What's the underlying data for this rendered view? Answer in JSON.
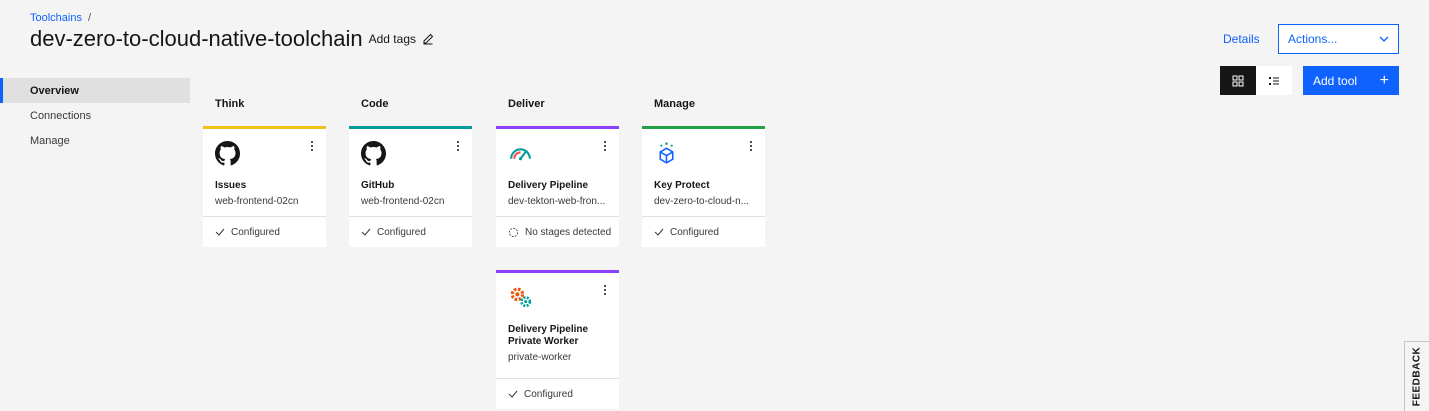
{
  "breadcrumb": {
    "link": "Toolchains",
    "separator": "/"
  },
  "page": {
    "title": "dev-zero-to-cloud-native-toolchain",
    "add_tags": "Add tags"
  },
  "header": {
    "details": "Details",
    "actions": "Actions..."
  },
  "toolbar": {
    "add_tool": "Add tool",
    "add_icon": "+"
  },
  "sidenav": {
    "items": [
      {
        "label": "Overview",
        "active": true
      },
      {
        "label": "Connections"
      },
      {
        "label": "Manage"
      }
    ]
  },
  "columns": [
    {
      "header": "Think",
      "color": "#f1c21b"
    },
    {
      "header": "Code",
      "color": "#009d9a"
    },
    {
      "header": "Deliver",
      "color": "#8a3ffc"
    },
    {
      "header": "Manage",
      "color": "#24a148"
    }
  ],
  "cards": {
    "issues": {
      "name": "Issues",
      "sub": "web-frontend-02cn",
      "status": "Configured",
      "icon": "github-icon"
    },
    "github": {
      "name": "GitHub",
      "sub": "web-frontend-02cn",
      "status": "Configured",
      "icon": "github-icon"
    },
    "pipeline": {
      "name": "Delivery Pipeline",
      "sub": "dev-tekton-web-fron...",
      "status": "No stages detected",
      "icon": "pipeline-gauge-icon"
    },
    "worker": {
      "name1": "Delivery Pipeline",
      "name2": "Private Worker",
      "sub": "private-worker",
      "status": "Configured",
      "icon": "private-worker-gears-icon"
    },
    "keyprotect": {
      "name": "Key Protect",
      "sub": "dev-zero-to-cloud-n...",
      "status": "Configured",
      "icon": "key-protect-cube-icon"
    }
  },
  "feedback": "FEEDBACK"
}
